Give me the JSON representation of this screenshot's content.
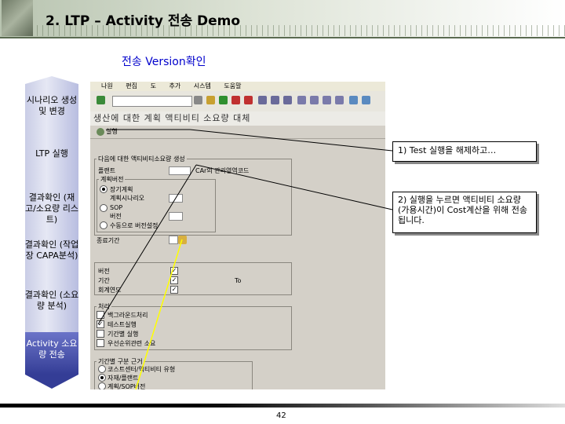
{
  "slide": {
    "title": "2. LTP – Activity 전송 Demo",
    "subtitle": "전송 Version확인",
    "page_number": "42"
  },
  "flow_steps": [
    {
      "label": "시나리오 생성 및 변경",
      "active": false
    },
    {
      "label": "LTP 실행",
      "active": false
    },
    {
      "label": "결과확인 (재고/소요량 리스트)",
      "active": false
    },
    {
      "label": "결과확인 (작업장 CAPA분석)",
      "active": false
    },
    {
      "label": "결과확인 (소요량 분석)",
      "active": false
    },
    {
      "label": "Activity 소요량 전송",
      "active": true
    }
  ],
  "callouts": [
    {
      "text": "1) Test 실행을 해제하고…"
    },
    {
      "text": "2) 실행을 누르면 액티비티 소요량(가용시간)이 Cost계산을 위해 전송됩니다."
    }
  ],
  "sap": {
    "menu": [
      "나원",
      "편집",
      "도",
      "추가",
      "시스템",
      "도움말"
    ],
    "title": "생산에 대한 계획 액티비티 소요량 대체",
    "execute_label": "실행",
    "sel_group": "다음에 대한 액티비티소요량 생성",
    "plant_label": "플랜트",
    "co_area_label": "CAr의 관리영역코드",
    "plan_version_group": "계획버전",
    "opt_plan_version": "장기계획",
    "lbl_plan_scenario": "계획시나리오",
    "opt_sop": "SOP",
    "lbl_version": "버전",
    "opt_manual": "수동으로 버전설정",
    "lbl_plan_period": "종료기간",
    "lbl_period": "기간",
    "lbl_to": "To",
    "lbl_fiscal_year": "회계연도",
    "proc_group": "처리",
    "chk_background": "백그라운드처리",
    "chk_test_run": "테스트실행",
    "chk_period_log": "기간별 실행",
    "chk_overwrite": "우선순위관련 소요",
    "period_group": "기간별 구분 근거",
    "opt_coord": "코스트센터/액티비티 유형",
    "opt_plant": "자재/플랜트",
    "opt_cat": "계획/SOP버전"
  }
}
